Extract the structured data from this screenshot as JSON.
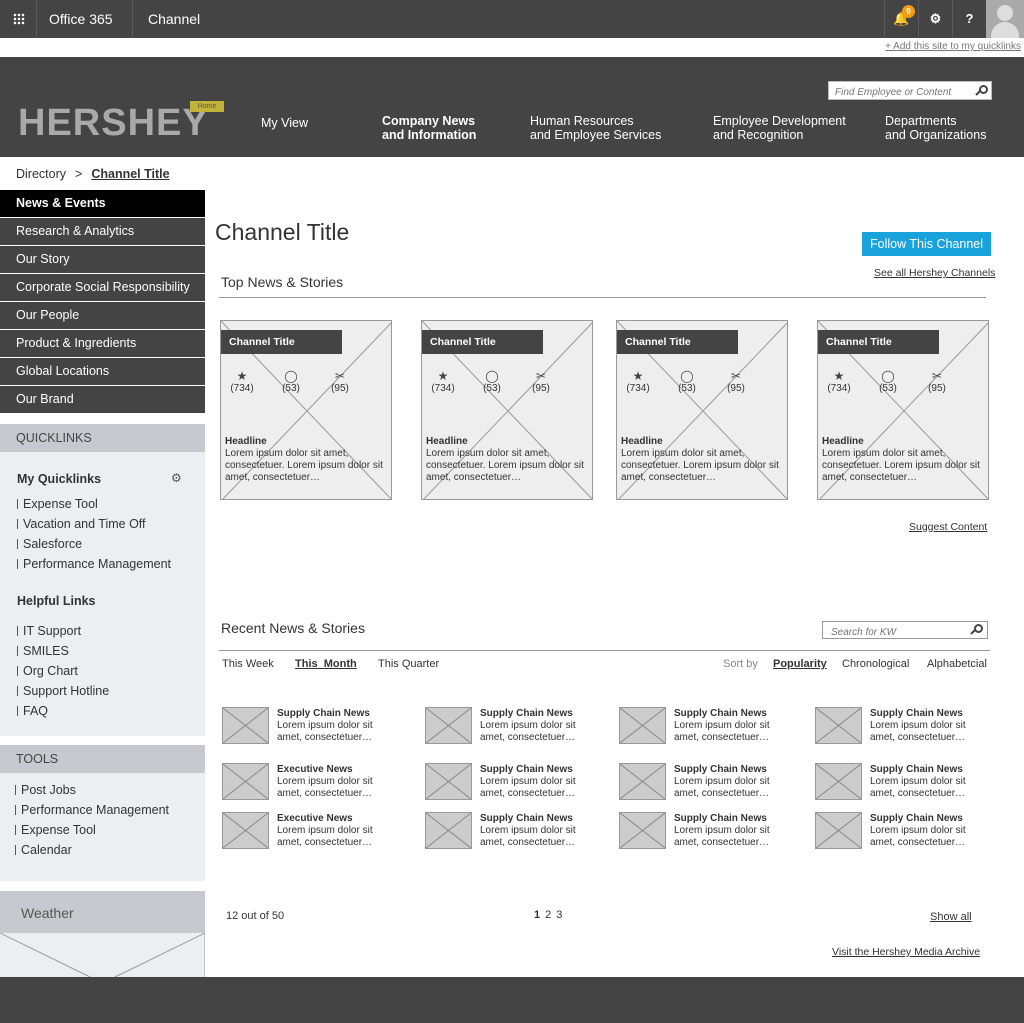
{
  "topbar": {
    "app_name": "Office 365",
    "site_name": "Channel",
    "notification_count": "9",
    "help_label": "?"
  },
  "add_quicklink": "+ Add this site to my quicklinks",
  "header": {
    "logo": "HERSHEY",
    "logo_tag": "Home",
    "search_placeholder": "Find Employee or Content",
    "nav": [
      {
        "line1": "My View",
        "line2": ""
      },
      {
        "line1": "Company News",
        "line2": "and Information"
      },
      {
        "line1": "Human Resources",
        "line2": "and Employee Services"
      },
      {
        "line1": "Employee Development",
        "line2": "and Recognition"
      },
      {
        "line1": "Departments",
        "line2": "and Organizations"
      }
    ]
  },
  "breadcrumb": {
    "root": "Directory",
    "sep": ">",
    "current": "Channel Title"
  },
  "sidenav": [
    "News & Events",
    "Research & Analytics",
    "Our Story",
    "Corporate Social Responsibility",
    "Our People",
    "Product & Ingredients",
    "Global Locations",
    "Our Brand"
  ],
  "quicklinks": {
    "title": "QUICKLINKS",
    "my_title": "My Quicklinks",
    "my_items": [
      "Expense Tool",
      "Vacation and Time Off",
      "Salesforce",
      "Performance Management"
    ],
    "helpful_title": "Helpful Links",
    "helpful_items": [
      "IT Support",
      "SMILES",
      "Org Chart",
      "Support Hotline",
      "FAQ"
    ]
  },
  "tools": {
    "title": "TOOLS",
    "items": [
      "Post Jobs",
      "Performance Management",
      "Expense Tool",
      "Calendar"
    ]
  },
  "weather": {
    "title": "Weather"
  },
  "main": {
    "title": "Channel Title",
    "follow_label": "Follow This Channel",
    "top_title": "Top News & Stories",
    "see_all": "See all Hershey Channels",
    "suggest": "Suggest Content",
    "recent_title": "Recent News & Stories",
    "search_placeholder": "Search for KW",
    "filters": [
      "This Week",
      "This  Month",
      "This Quarter"
    ],
    "sort_label": "Sort by",
    "sorts": [
      "Popularity",
      "Chronological",
      "Alphabetcial"
    ],
    "count": "12 out of 50",
    "pages": [
      "1",
      "2",
      "3"
    ],
    "show_all": "Show all",
    "archive": "Visit the Hershey Media Archive"
  },
  "cards": [
    {
      "title": "Channel Title",
      "likes": "(734)",
      "comments": "(53)",
      "shares": "(95)",
      "headline": "Headline",
      "body": "Lorem ipsum dolor sit amet, consectetuer. Lorem ipsum dolor sit amet, consectetuer…"
    },
    {
      "title": "Channel Title",
      "likes": "(734)",
      "comments": "(53)",
      "shares": "(95)",
      "headline": "Headline",
      "body": "Lorem ipsum dolor sit amet, consectetuer. Lorem ipsum dolor sit amet, consectetuer…"
    },
    {
      "title": "Channel Title",
      "likes": "(734)",
      "comments": "(53)",
      "shares": "(95)",
      "headline": "Headline",
      "body": "Lorem ipsum dolor sit amet, consectetuer. Lorem ipsum dolor sit amet, consectetuer…"
    },
    {
      "title": "Channel Title",
      "likes": "(734)",
      "comments": "(53)",
      "shares": "(95)",
      "headline": "Headline",
      "body": "Lorem ipsum dolor sit amet, consectetuer. Lorem ipsum dolor sit amet, consectetuer…"
    }
  ],
  "recent": [
    {
      "title": "Supply Chain News",
      "body": "Lorem ipsum dolor sit amet, consectetuer…"
    },
    {
      "title": "Supply Chain News",
      "body": "Lorem ipsum dolor sit amet, consectetuer…"
    },
    {
      "title": "Supply Chain News",
      "body": "Lorem ipsum dolor sit amet, consectetuer…"
    },
    {
      "title": "Supply Chain News",
      "body": "Lorem ipsum dolor sit amet, consectetuer…"
    },
    {
      "title": "Executive News",
      "body": "Lorem ipsum dolor sit amet, consectetuer…"
    },
    {
      "title": "Supply Chain News",
      "body": "Lorem ipsum dolor sit amet, consectetuer…"
    },
    {
      "title": "Supply Chain News",
      "body": "Lorem ipsum dolor sit amet, consectetuer…"
    },
    {
      "title": "Supply Chain News",
      "body": "Lorem ipsum dolor sit amet, consectetuer…"
    },
    {
      "title": "Executive News",
      "body": "Lorem ipsum dolor sit amet, consectetuer…"
    },
    {
      "title": "Supply Chain News",
      "body": "Lorem ipsum dolor sit amet, consectetuer…"
    },
    {
      "title": "Supply Chain News",
      "body": "Lorem ipsum dolor sit amet, consectetuer…"
    },
    {
      "title": "Supply Chain News",
      "body": "Lorem ipsum dolor sit amet, consectetuer…"
    }
  ],
  "colors": {
    "dark": "#444444",
    "accent": "#1aa2dc",
    "badge": "#f39c12",
    "panel": "#eceef1"
  }
}
